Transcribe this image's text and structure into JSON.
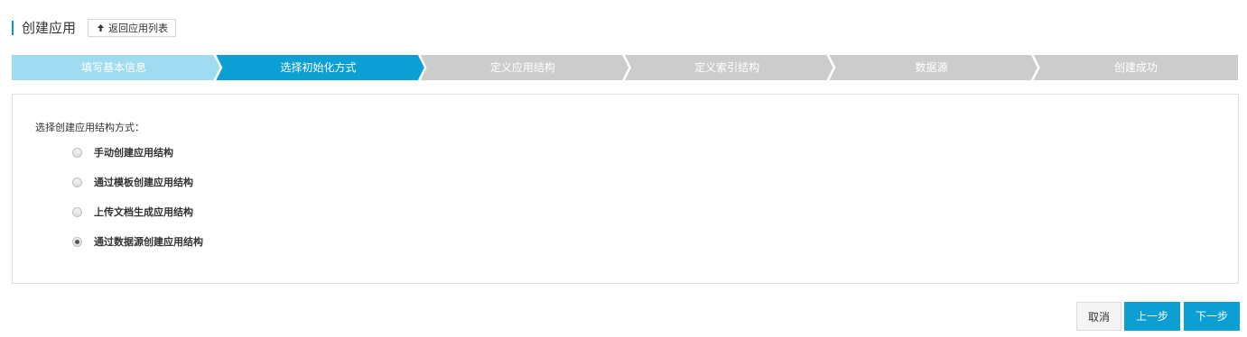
{
  "header": {
    "title": "创建应用",
    "back_label": "返回应用列表"
  },
  "steps": [
    {
      "label": "填写基本信息",
      "state": "done"
    },
    {
      "label": "选择初始化方式",
      "state": "active"
    },
    {
      "label": "定义应用结构",
      "state": "pending"
    },
    {
      "label": "定义索引结构",
      "state": "pending"
    },
    {
      "label": "数据源",
      "state": "pending"
    },
    {
      "label": "创建成功",
      "state": "pending"
    }
  ],
  "colors": {
    "done": "#9fdcf2",
    "active": "#0c9fd3",
    "pending": "#cccccc",
    "accent": "#0099cc"
  },
  "form": {
    "label": "选择创建应用结构方式：",
    "options": [
      {
        "label": "手动创建应用结构",
        "selected": false
      },
      {
        "label": "通过模板创建应用结构",
        "selected": false
      },
      {
        "label": "上传文档生成应用结构",
        "selected": false
      },
      {
        "label": "通过数据源创建应用结构",
        "selected": true
      }
    ]
  },
  "footer": {
    "cancel_label": "取消",
    "prev_label": "上一步",
    "next_label": "下一步"
  }
}
